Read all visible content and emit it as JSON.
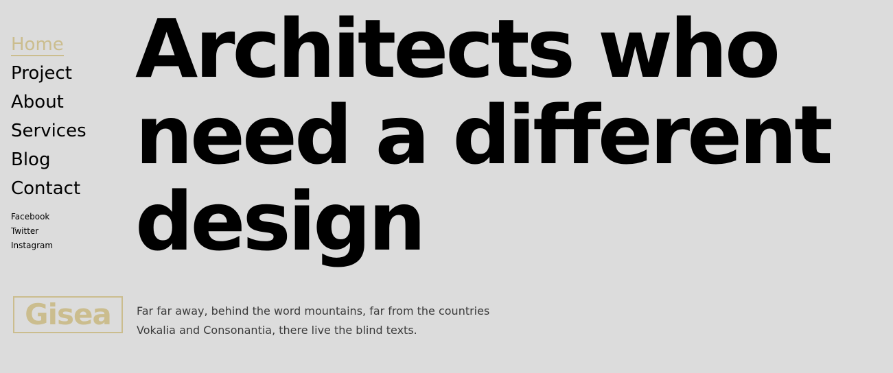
{
  "nav": {
    "items": [
      {
        "label": "Home",
        "active": true
      },
      {
        "label": "Project",
        "active": false
      },
      {
        "label": "About",
        "active": false
      },
      {
        "label": "Services",
        "active": false
      },
      {
        "label": "Blog",
        "active": false
      },
      {
        "label": "Contact",
        "active": false
      }
    ]
  },
  "social": {
    "links": [
      {
        "label": "Facebook"
      },
      {
        "label": "Twitter"
      },
      {
        "label": "Instagram"
      }
    ]
  },
  "brand": {
    "logo_text": "Gisea"
  },
  "hero": {
    "headline_lines": [
      "Architects who",
      "need a different",
      "design"
    ],
    "description_lines": [
      "Far far away, behind the word mountains, far from the countries",
      "Vokalia and Consonantia, there live the blind texts."
    ]
  },
  "colors": {
    "background": "#dcdcdc",
    "accent": "#cbbd8e",
    "text": "#000000",
    "body_text": "#3a3a3a"
  }
}
